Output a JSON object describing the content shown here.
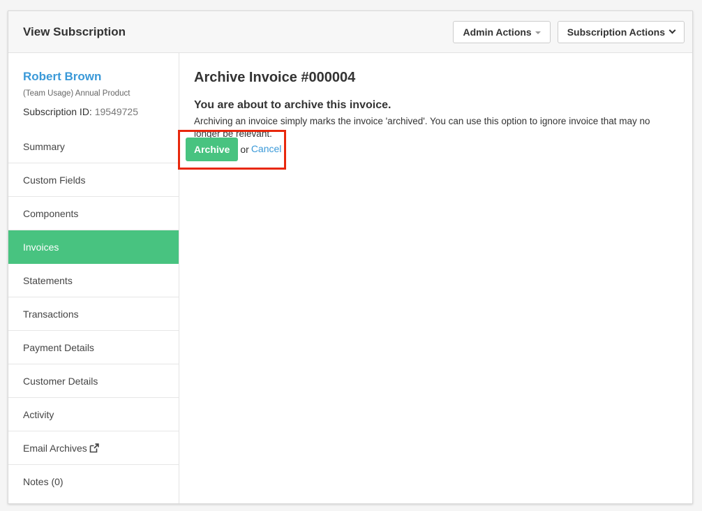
{
  "header": {
    "title": "View Subscription",
    "admin_actions_label": "Admin Actions",
    "subscription_actions_label": "Subscription Actions"
  },
  "customer": {
    "name": "Robert Brown",
    "product": "(Team Usage) Annual Product",
    "subscription_id_label": "Subscription ID:",
    "subscription_id": "19549725"
  },
  "sidebar": {
    "items": [
      {
        "label": "Summary"
      },
      {
        "label": "Custom Fields"
      },
      {
        "label": "Components"
      },
      {
        "label": "Invoices"
      },
      {
        "label": "Statements"
      },
      {
        "label": "Transactions"
      },
      {
        "label": "Payment Details"
      },
      {
        "label": "Customer Details"
      },
      {
        "label": "Activity"
      },
      {
        "label": "Email Archives"
      },
      {
        "label": "Notes (0)"
      }
    ],
    "active_item": "Invoices"
  },
  "main": {
    "title": "Archive Invoice #000004",
    "subtitle": "You are about to archive this invoice.",
    "description": "Archiving an invoice simply marks the invoice 'archived'. You can use this option to ignore invoice that may no longer be relevant.",
    "archive_label": "Archive",
    "or_text": "or",
    "cancel_label": "Cancel"
  },
  "colors": {
    "accent_green": "#48c380",
    "link_blue": "#3a99d8",
    "highlight_red": "#e8280d"
  }
}
